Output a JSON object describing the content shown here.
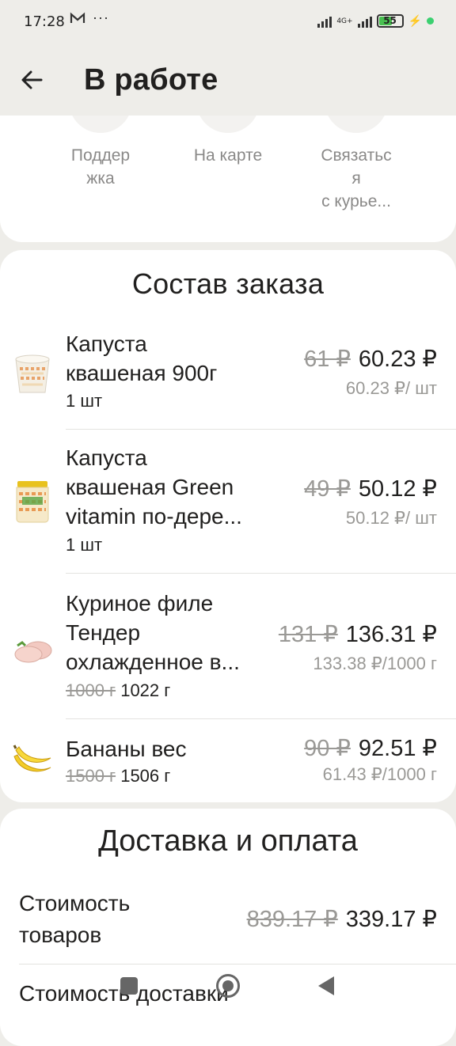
{
  "status_bar": {
    "time": "17:28",
    "mail_icon": "M",
    "more": "···",
    "network": "4G+",
    "battery": "55"
  },
  "header": {
    "title": "В работе"
  },
  "actions": [
    {
      "icon": "support-icon",
      "label": "Поддер\nжка"
    },
    {
      "icon": "map-icon",
      "label": "На карте"
    },
    {
      "icon": "phone-icon",
      "label": "Связатьс\nя\nс курье..."
    }
  ],
  "order": {
    "title": "Состав заказа",
    "items": [
      {
        "name": "Капуста\nквашеная 900г",
        "qty_old": "",
        "qty": "1 шт",
        "old_price": "61 ₽",
        "price": "60.23 ₽",
        "unit_price": "60.23 ₽/ шт"
      },
      {
        "name": "Капуста\nквашеная Green\nvitamin по-дере...",
        "qty_old": "",
        "qty": "1 шт",
        "old_price": "49 ₽",
        "price": "50.12 ₽",
        "unit_price": "50.12 ₽/ шт"
      },
      {
        "name": "Куриное филе\nТендер\nохлажденное в...",
        "qty_old": "1000 г",
        "qty": "1022 г",
        "old_price": "131 ₽",
        "price": "136.31 ₽",
        "unit_price": "133.38 ₽/1000 г"
      },
      {
        "name": "Бананы вес",
        "qty_old": "1500 г",
        "qty": "1506 г",
        "old_price": "90 ₽",
        "price": "92.51 ₽",
        "unit_price": "61.43 ₽/1000 г"
      }
    ]
  },
  "delivery": {
    "title": "Доставка и оплата",
    "goods_label": "Стоимость\nтоваров",
    "goods_old": "839.17 ₽",
    "goods_value": "339.17 ₽",
    "delivery_label": "Стоимость доставки"
  },
  "colors": {
    "background": "#eeede9",
    "card": "#ffffff",
    "muted": "#9a9996",
    "battery": "#48c050"
  }
}
